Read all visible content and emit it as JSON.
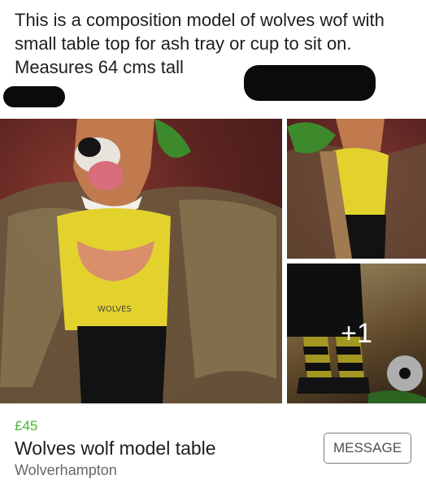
{
  "post": {
    "description": "This is a composition model of wolves wof with small table top for ash tray or cup to sit on. Measures 64 cms tall"
  },
  "gallery": {
    "extra_count": "+1"
  },
  "listing": {
    "price": "£45",
    "title": "Wolves wolf model table",
    "location": "Wolverhampton",
    "message_label": "MESSAGE"
  },
  "colors": {
    "price": "#42b72a",
    "text": "#1c1e21",
    "secondary": "#65676b"
  }
}
